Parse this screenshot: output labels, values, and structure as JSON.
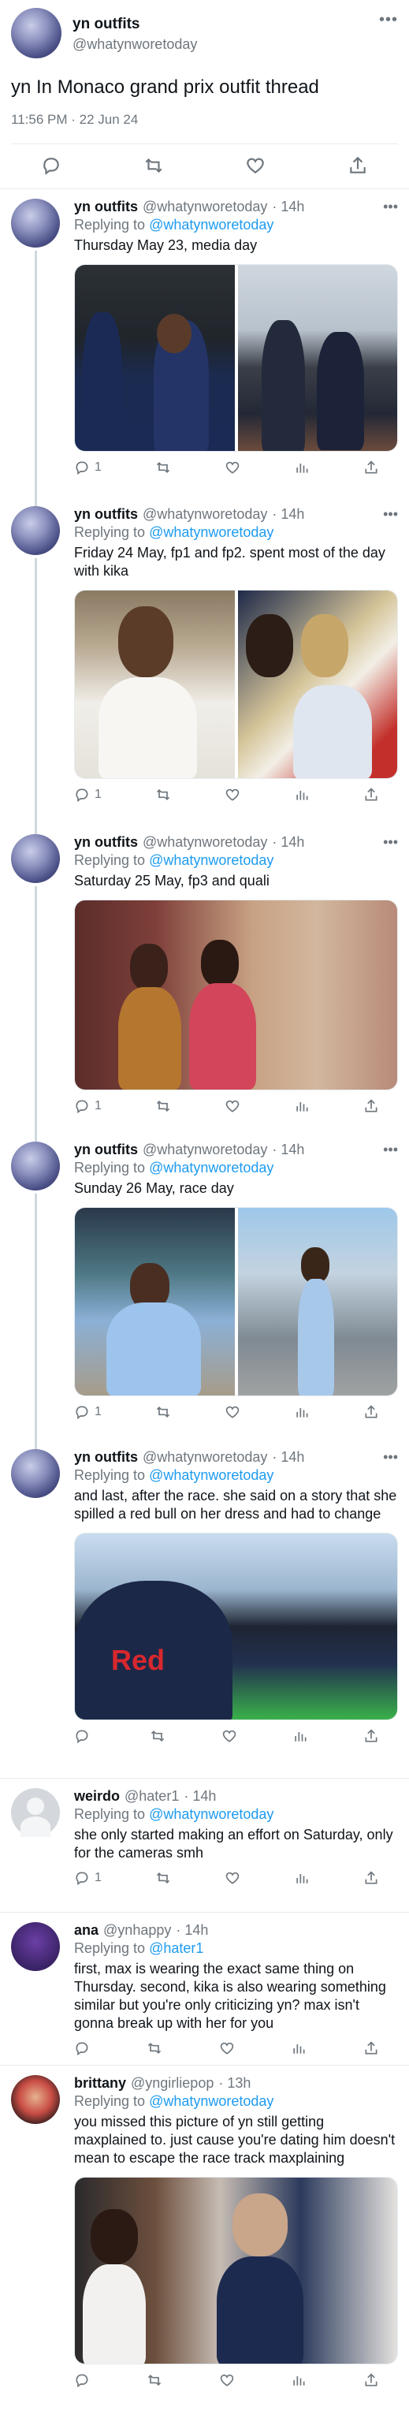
{
  "main": {
    "name": "yn outfits",
    "handle": "@whatynworetoday",
    "more": "•••",
    "text": "yn In Monaco grand prix outfit thread",
    "timestamp": "11:56 PM · 22 Jun 24"
  },
  "replies": [
    {
      "name": "yn outfits",
      "handle": "@whatynworetoday",
      "time": "· 14h",
      "replying_to_prefix": "Replying to ",
      "replying_to": "@whatynworetoday",
      "text": "Thursday May 23, media day",
      "replies": "1",
      "retweets": "",
      "likes": "",
      "more": "•••"
    },
    {
      "name": "yn outfits",
      "handle": "@whatynworetoday",
      "time": "· 14h",
      "replying_to_prefix": "Replying to ",
      "replying_to": "@whatynworetoday",
      "text": "Friday 24 May, fp1 and fp2. spent most of the day with kika",
      "replies": "1",
      "retweets": "",
      "likes": "",
      "more": "•••"
    },
    {
      "name": "yn outfits",
      "handle": "@whatynworetoday",
      "time": "· 14h",
      "replying_to_prefix": "Replying to ",
      "replying_to": "@whatynworetoday",
      "text": "Saturday 25 May, fp3 and quali",
      "replies": "1",
      "retweets": "",
      "likes": "",
      "more": "•••"
    },
    {
      "name": "yn outfits",
      "handle": "@whatynworetoday",
      "time": "· 14h",
      "replying_to_prefix": "Replying to ",
      "replying_to": "@whatynworetoday",
      "text": "Sunday 26 May, race day",
      "replies": "1",
      "retweets": "",
      "likes": "",
      "more": "•••"
    },
    {
      "name": "yn outfits",
      "handle": "@whatynworetoday",
      "time": "· 14h",
      "replying_to_prefix": "Replying to ",
      "replying_to": "@whatynworetoday",
      "text": "and last, after the race. she said on a story that she spilled a red bull on her dress and had to change",
      "replies": "",
      "retweets": "",
      "likes": "",
      "more": "•••"
    },
    {
      "name": "weirdo",
      "handle": "@hater1",
      "time": "· 14h",
      "replying_to_prefix": "Replying to ",
      "replying_to": "@whatynworetoday",
      "text": "she only started making an effort on Saturday, only for the cameras smh",
      "replies": "1",
      "retweets": "",
      "likes": "",
      "more": ""
    },
    {
      "name": "ana",
      "handle": "@ynhappy",
      "time": "· 14h",
      "replying_to_prefix": "Replying to ",
      "replying_to": "@hater1",
      "text": "first, max is wearing the exact same thing on Thursday. second, kika is also wearing something similar but you're only criticizing yn? max isn't gonna break up with her for you",
      "replies": "",
      "retweets": "",
      "likes": "",
      "more": ""
    },
    {
      "name": "brittany",
      "handle": "@yngirliepop",
      "time": "· 13h",
      "replying_to_prefix": "Replying to ",
      "replying_to": "@whatynworetoday",
      "text": "you missed this picture of yn still getting maxplained to. just cause you're dating him doesn't mean to escape the race track maxplaining",
      "replies": "",
      "retweets": "",
      "likes": "",
      "more": ""
    }
  ],
  "colors": {
    "link": "#1d9bf0",
    "muted": "#6e767d",
    "divider": "#e6ecf0",
    "thread_line": "#cfd9de"
  },
  "icons": [
    "reply-icon",
    "retweet-icon",
    "like-icon",
    "analytics-icon",
    "share-icon",
    "more-icon"
  ]
}
